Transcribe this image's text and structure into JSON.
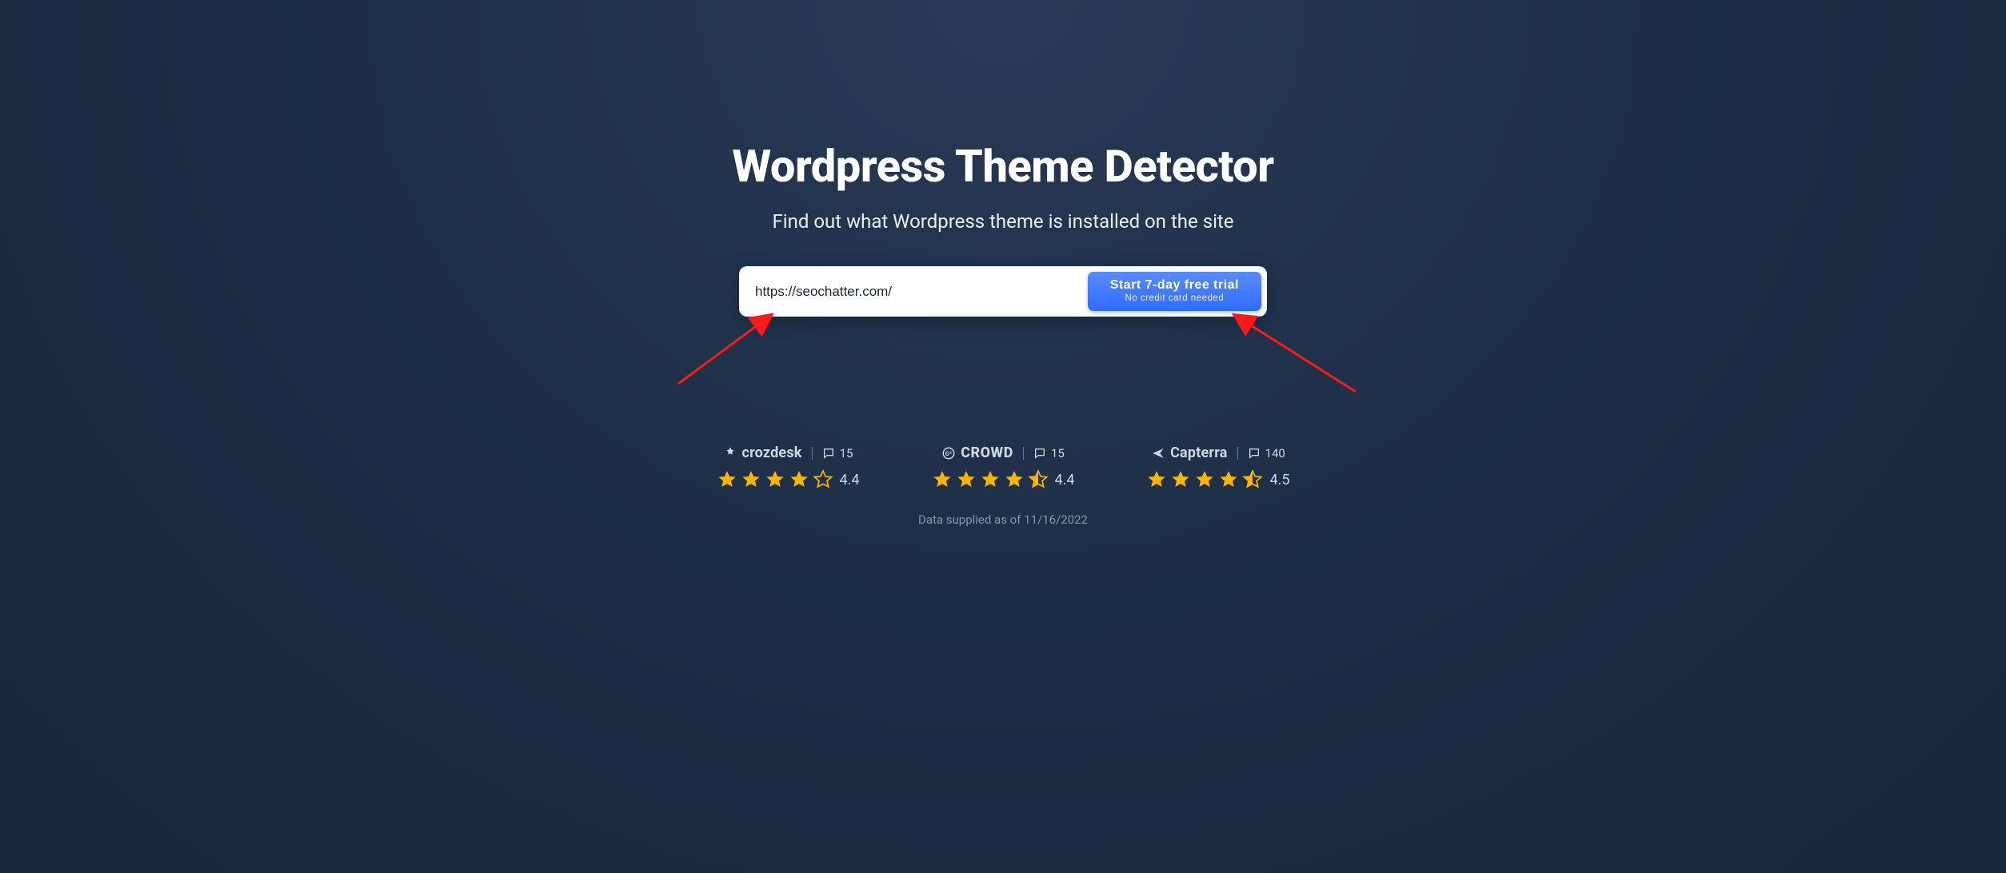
{
  "header": {
    "title": "Wordpress Theme Detector",
    "subtitle": "Find out what Wordpress theme is installed on the site"
  },
  "form": {
    "url_value": "https://seochatter.com/",
    "cta_main": "Start 7-day free trial",
    "cta_sub": "No credit card needed"
  },
  "annotations": {
    "arrow_color": "#ff1a1a"
  },
  "ratings": {
    "star_fill": "#ffb400",
    "star_empty": "#cfd6e2",
    "items": [
      {
        "brand": "crozdesk",
        "brand_logo": "crozdesk-icon",
        "reviews": "15",
        "score": "4.4",
        "stars_pattern": "FFFF_E"
      },
      {
        "brand": "CROWD",
        "brand_logo": "g2-icon",
        "reviews": "15",
        "score": "4.4",
        "stars_pattern": "FFFFH"
      },
      {
        "brand": "Capterra",
        "brand_logo": "capterra-icon",
        "reviews": "140",
        "score": "4.5",
        "stars_pattern": "FFFFH"
      }
    ],
    "supplied_note": "Data supplied as of 11/16/2022"
  }
}
